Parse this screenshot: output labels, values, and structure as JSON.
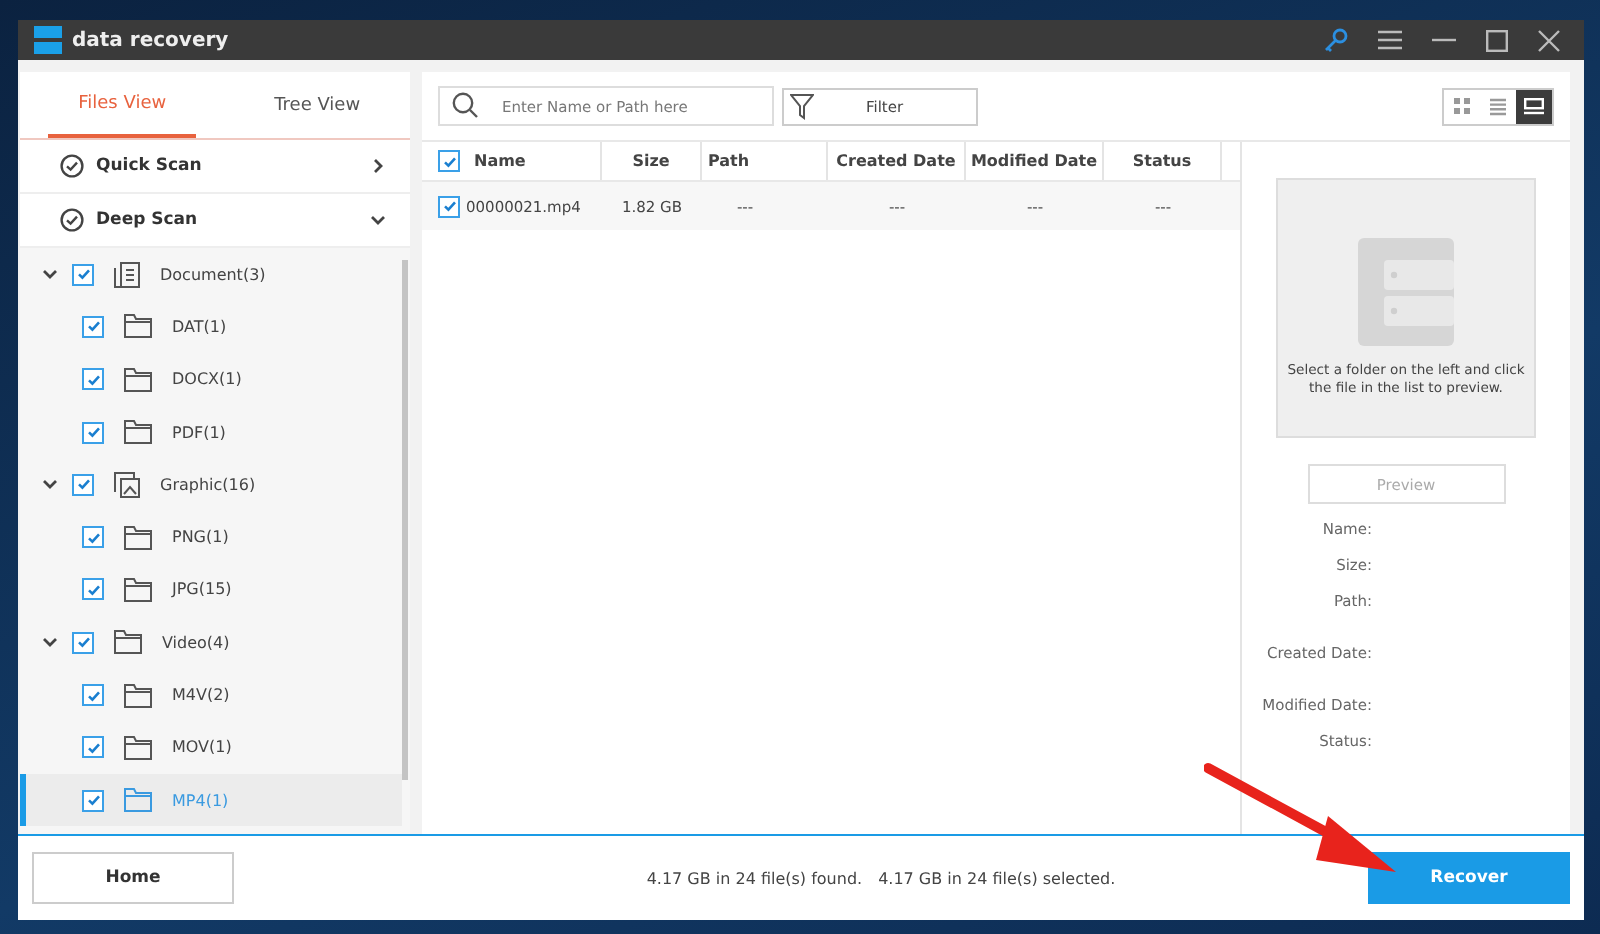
{
  "window": {
    "title": "data recovery"
  },
  "title_bar_buttons": [
    {
      "kind": "key"
    },
    {
      "kind": "menu"
    },
    {
      "kind": "minimize"
    },
    {
      "kind": "maximize"
    },
    {
      "kind": "close"
    }
  ],
  "view_tabs": [
    {
      "label": "Files View",
      "selected": true
    },
    {
      "label": "Tree View",
      "selected": false
    }
  ],
  "scan_modes": [
    {
      "label": "Quick Scan",
      "expanded": false
    },
    {
      "label": "Deep Scan",
      "expanded": true
    }
  ],
  "tree": [
    {
      "label": "Document(3)",
      "kind": "document",
      "checked": true,
      "expanded": true,
      "selected": false,
      "children": [
        {
          "label": "DAT(1)",
          "checked": true,
          "selected": false
        },
        {
          "label": "DOCX(1)",
          "checked": true,
          "selected": false
        },
        {
          "label": "PDF(1)",
          "checked": true,
          "selected": false
        }
      ]
    },
    {
      "label": "Graphic(16)",
      "kind": "graphic",
      "checked": true,
      "expanded": true,
      "selected": false,
      "children": [
        {
          "label": "PNG(1)",
          "checked": true,
          "selected": false
        },
        {
          "label": "JPG(15)",
          "checked": true,
          "selected": false
        }
      ]
    },
    {
      "label": "Video(4)",
      "kind": "folder",
      "checked": true,
      "expanded": true,
      "selected": false,
      "children": [
        {
          "label": "M4V(2)",
          "checked": true,
          "selected": false
        },
        {
          "label": "MOV(1)",
          "checked": true,
          "selected": false
        },
        {
          "label": "MP4(1)",
          "checked": true,
          "selected": true
        }
      ]
    }
  ],
  "search": {
    "placeholder": "Enter Name or Path here"
  },
  "filter_button": "Filter",
  "view_modes": [
    {
      "kind": "grid",
      "selected": false
    },
    {
      "kind": "list",
      "selected": false
    },
    {
      "kind": "preview",
      "selected": true
    }
  ],
  "table": {
    "all_checked": true,
    "columns": [
      "Name",
      "Size",
      "Path",
      "Created Date",
      "Modified Date",
      "Status"
    ],
    "rows": [
      {
        "checked": true,
        "cells": [
          "00000021.mp4",
          "1.82 GB",
          "---",
          "---",
          "---",
          "---"
        ]
      }
    ]
  },
  "preview": {
    "message": "Select a folder on the left and click the file in the list to preview.",
    "button": "Preview",
    "fields": [
      "Name:",
      "Size:",
      "Path:",
      "Created Date:",
      "Modified Date:",
      "Status:"
    ]
  },
  "footer": {
    "home_button": "Home",
    "found_text": "4.17 GB in 24 file(s) found.",
    "selected_text": "4.17 GB in 24 file(s) selected.",
    "recover_button": "Recover"
  }
}
